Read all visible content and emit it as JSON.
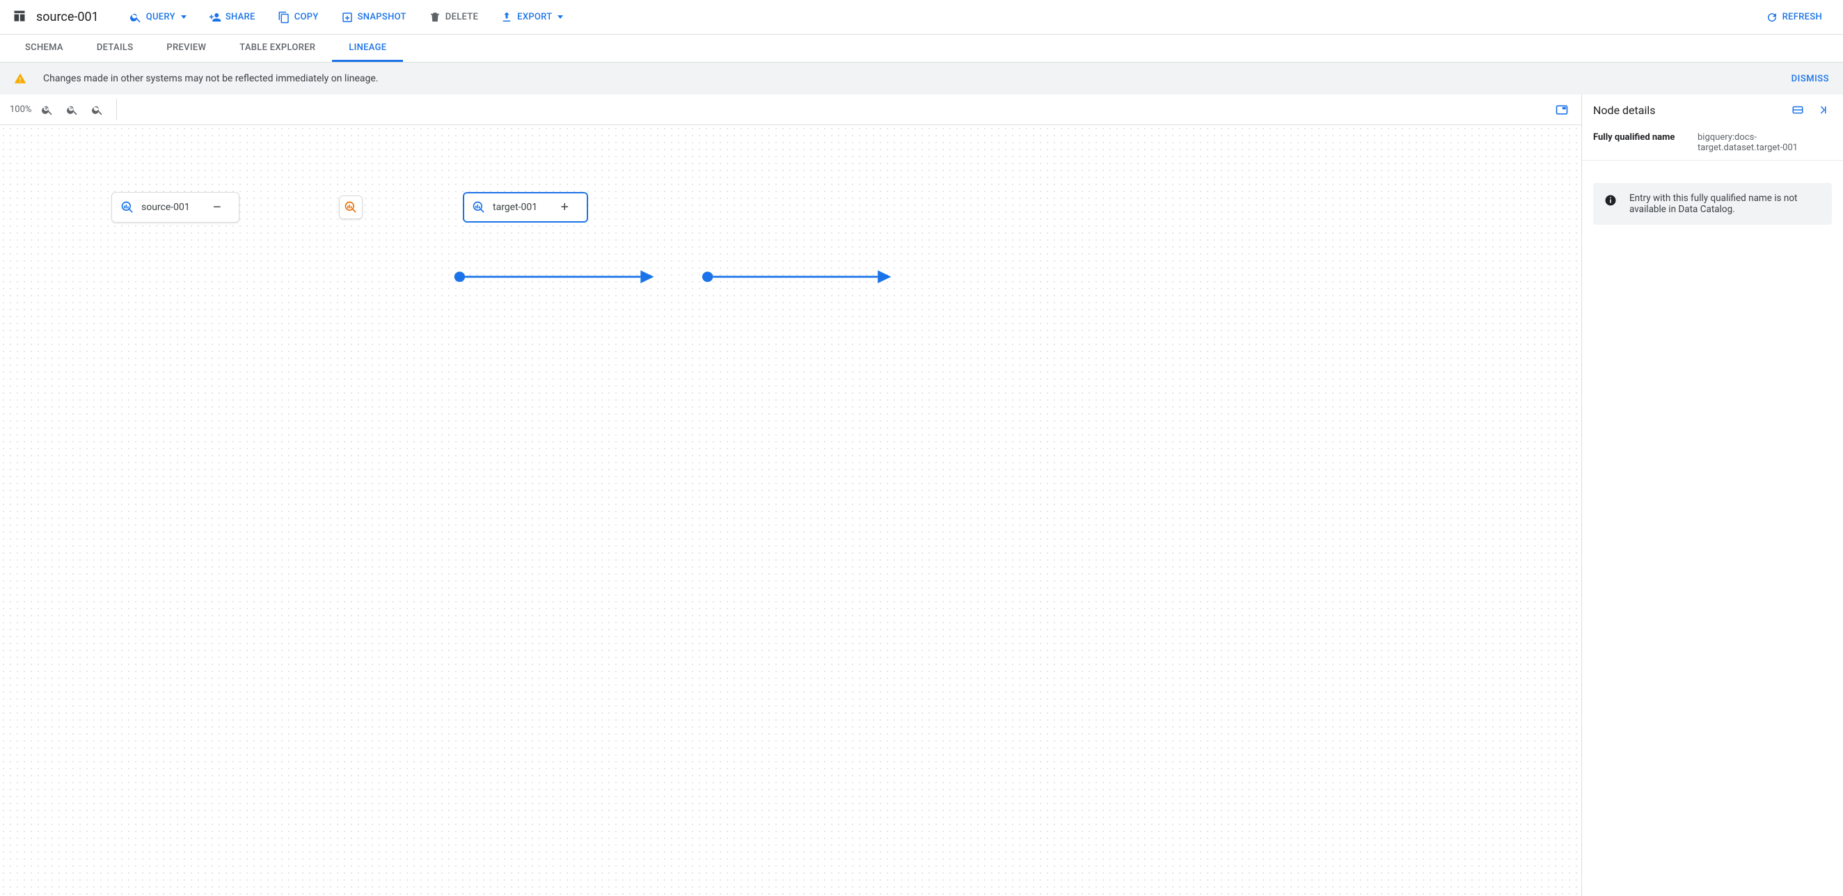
{
  "header": {
    "title": "source-001",
    "actions": {
      "query": "Query",
      "share": "Share",
      "copy": "Copy",
      "snapshot": "Snapshot",
      "delete": "Delete",
      "export": "Export",
      "refresh": "Refresh"
    }
  },
  "tabs": {
    "schema": "Schema",
    "details": "Details",
    "preview": "Preview",
    "table_explorer": "Table Explorer",
    "lineage": "Lineage"
  },
  "banner": {
    "message": "Changes made in other systems may not be reflected immediately on lineage.",
    "dismiss": "Dismiss"
  },
  "canvas": {
    "zoom": "100%"
  },
  "lineage": {
    "source": {
      "label": "source-001",
      "expand_collapse": "−"
    },
    "target": {
      "label": "target-001",
      "expand_collapse": "+"
    }
  },
  "details": {
    "title": "Node details",
    "fqn_label": "Fully qualified name",
    "fqn_value": "bigquery:docs-target.dataset.target-001",
    "note": "Entry with this fully qualified name is not available in Data Catalog."
  }
}
